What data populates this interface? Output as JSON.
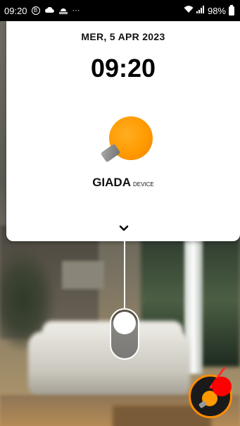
{
  "status_bar": {
    "time": "09:20",
    "b_icon_letter": "B",
    "more": "···",
    "battery_text": "98%"
  },
  "card": {
    "date": "MER, 5 APR 2023",
    "time": "09:20",
    "device_name": "GIADA",
    "device_type": "DEVICE"
  },
  "icons": {
    "weather1": "cloud-icon",
    "weather2": "sunrise-icon",
    "wifi": "wifi-icon",
    "signal": "signal-icon",
    "battery": "battery-icon",
    "bulb": "bulb-icon",
    "chevron": "chevron-down-icon"
  },
  "colors": {
    "accent": "#ff9a00",
    "indicator": "#ff0000"
  }
}
